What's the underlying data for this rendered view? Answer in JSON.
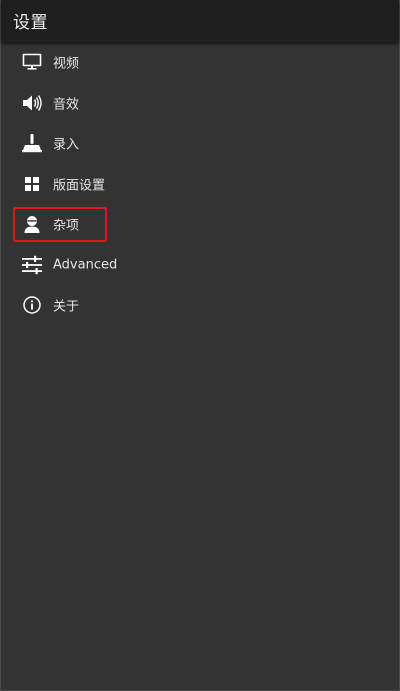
{
  "header": {
    "title": "设置"
  },
  "menu": {
    "items": [
      {
        "label": "视频",
        "icon": "monitor-icon"
      },
      {
        "label": "音效",
        "icon": "speaker-icon"
      },
      {
        "label": "录入",
        "icon": "joystick-icon"
      },
      {
        "label": "版面设置",
        "icon": "grid-icon"
      },
      {
        "label": "杂项",
        "icon": "user-icon",
        "highlighted": true
      },
      {
        "label": "Advanced",
        "icon": "sliders-icon"
      },
      {
        "label": "关于",
        "icon": "info-icon"
      }
    ]
  },
  "colors": {
    "background": "#333333",
    "header": "#1f1f1f",
    "text": "#e6e6e6",
    "icon": "#ffffff",
    "highlight": "#e0161b"
  }
}
